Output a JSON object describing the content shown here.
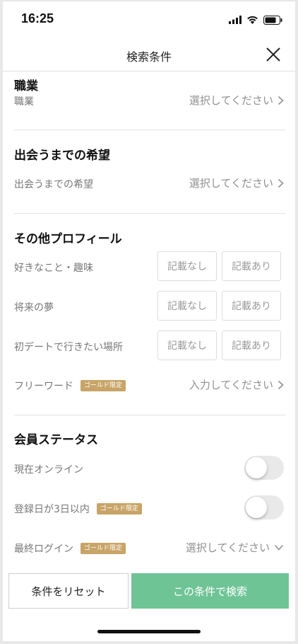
{
  "status_bar": {
    "time": "16:25",
    "icons": [
      "signal-icon",
      "wifi-icon",
      "battery-icon"
    ]
  },
  "header": {
    "title": "検索条件",
    "close_icon": "close-icon"
  },
  "sections": {
    "occupation": {
      "title": "職業",
      "label": "職業",
      "value": "選択してください"
    },
    "hope": {
      "title": "出会うまでの希望",
      "label": "出会うまでの希望",
      "value": "選択してください"
    },
    "other_profile": {
      "title": "その他プロフィール",
      "options": {
        "none": "記載なし",
        "exists": "記載あり"
      },
      "rows": [
        {
          "label": "好きなこと・趣味"
        },
        {
          "label": "将来の夢"
        },
        {
          "label": "初デートで行きたい場所"
        }
      ],
      "freeword": {
        "label": "フリーワード",
        "badge": "ゴールド限定",
        "value": "入力してください"
      }
    },
    "member_status": {
      "title": "会員ステータス",
      "online": {
        "label": "現在オンライン",
        "on": false
      },
      "registered": {
        "label": "登録日が3日以内",
        "badge": "ゴールド限定",
        "on": false
      },
      "last_login": {
        "label": "最終ログイン",
        "badge": "ゴールド限定",
        "value": "選択してください"
      }
    }
  },
  "footer": {
    "reset_label": "条件をリセット",
    "search_label": "この条件で検索"
  },
  "colors": {
    "accent_green": "#6fc496",
    "gold_badge": "#c8a467"
  }
}
